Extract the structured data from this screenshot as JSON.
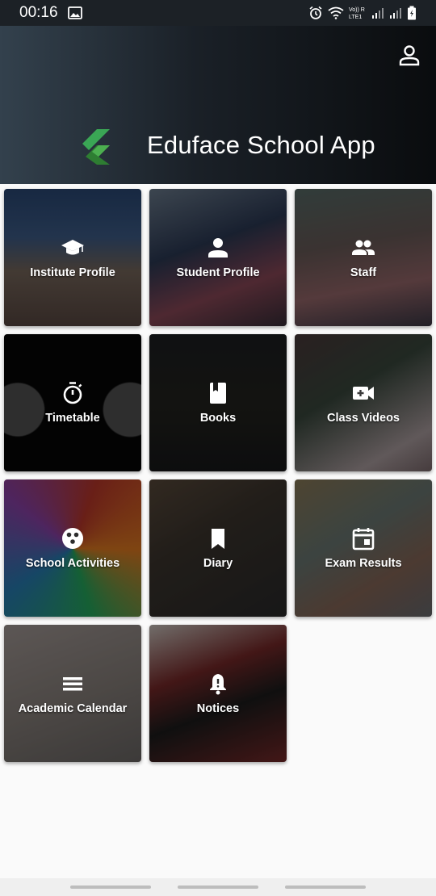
{
  "status": {
    "time": "00:16",
    "lte_label": "Vo)) R\nLTE1"
  },
  "header": {
    "title": "Eduface School App",
    "logo_color": "#3aa655",
    "profile_icon": "person-outline-icon"
  },
  "tiles": [
    {
      "label": "Institute Profile",
      "icon": "graduation-cap-icon"
    },
    {
      "label": "Student Profile",
      "icon": "person-icon"
    },
    {
      "label": "Staff",
      "icon": "people-icon"
    },
    {
      "label": "Timetable",
      "icon": "stopwatch-icon"
    },
    {
      "label": "Books",
      "icon": "book-icon"
    },
    {
      "label": "Class Videos",
      "icon": "video-add-icon"
    },
    {
      "label": "School Activities",
      "icon": "activity-icon"
    },
    {
      "label": "Diary",
      "icon": "bookmark-icon"
    },
    {
      "label": "Exam Results",
      "icon": "event-icon"
    },
    {
      "label": "Academic Calendar",
      "icon": "menu-lines-icon"
    },
    {
      "label": "Notices",
      "icon": "bell-alert-icon"
    }
  ]
}
